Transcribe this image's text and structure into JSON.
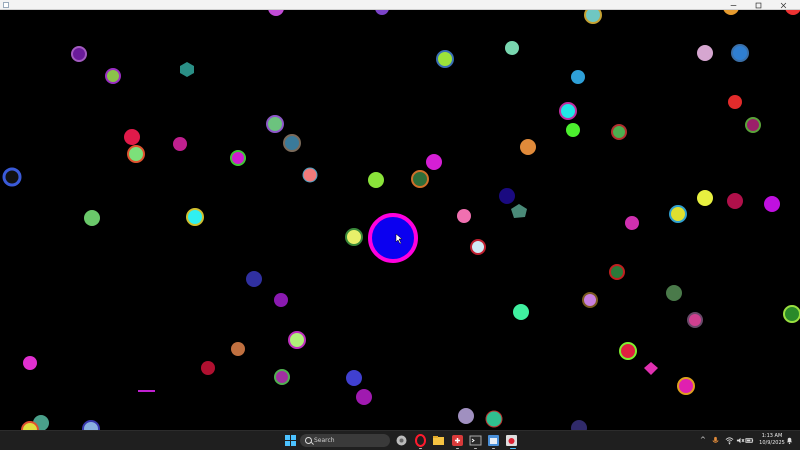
{
  "taskbar": {
    "search_placeholder": "Search",
    "time": "1:13 AM",
    "date": "10/9/2025"
  },
  "game": {
    "player": {
      "fill": "#0b00f0",
      "ring": "#ff00dd"
    }
  }
}
